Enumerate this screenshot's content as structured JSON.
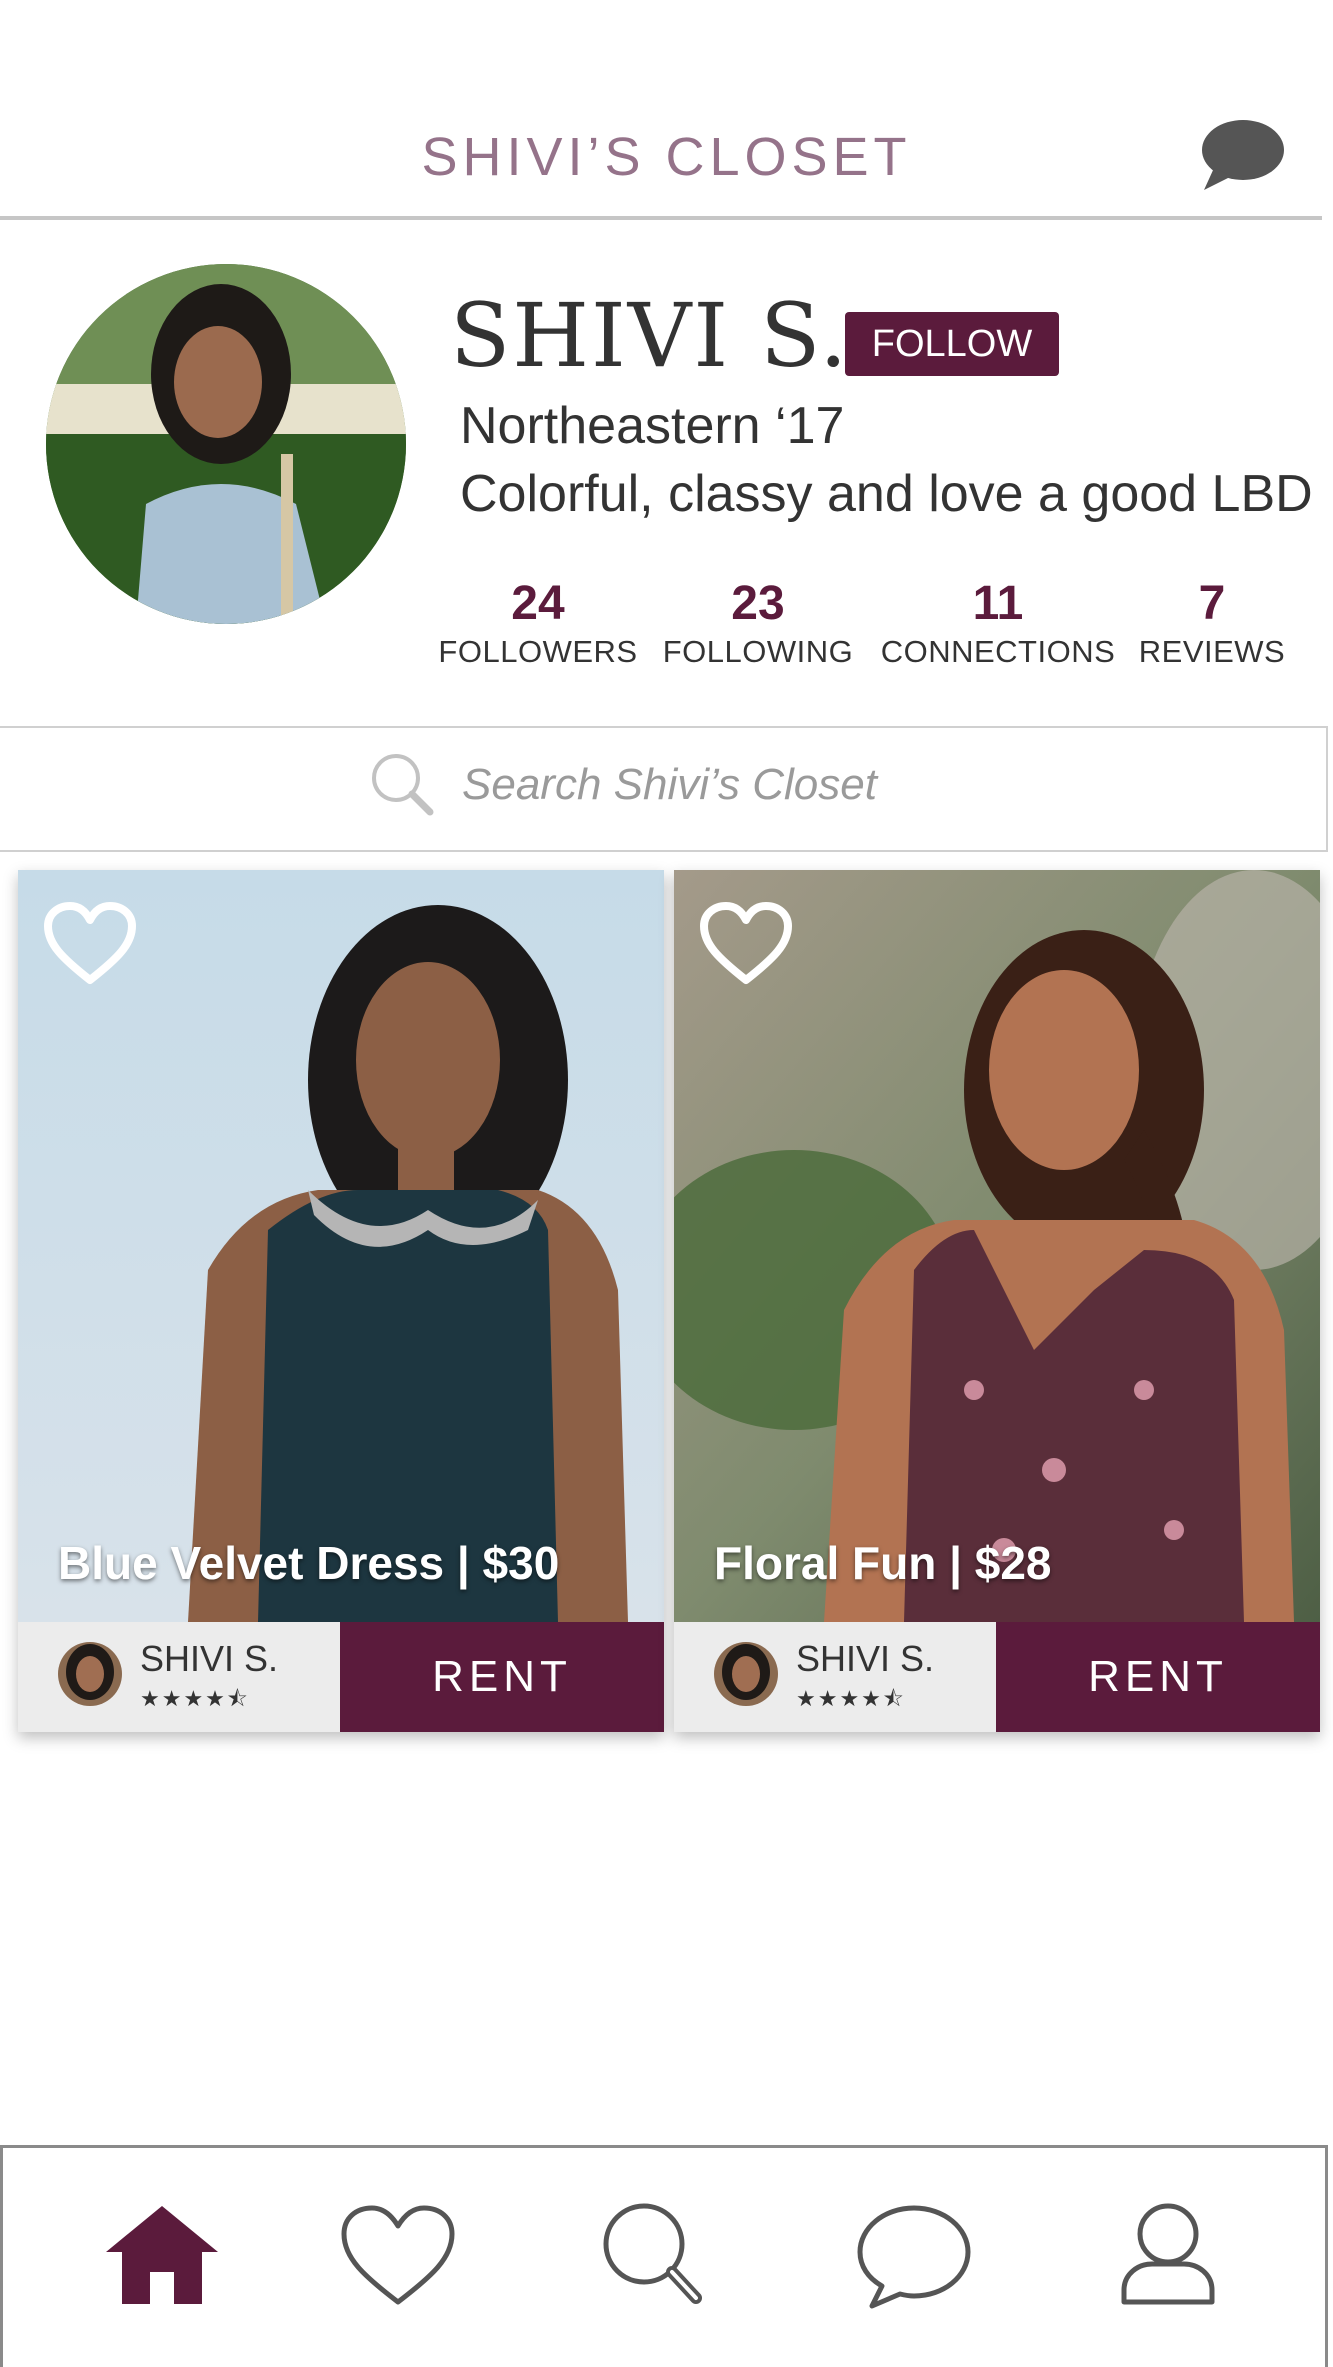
{
  "header": {
    "title": "SHIVI’S CLOSET",
    "chat_icon": "chat-bubble-icon"
  },
  "profile": {
    "name": "SHIVI S.",
    "follow_label": "FOLLOW",
    "school": "Northeastern ‘17",
    "bio": "Colorful, classy and love a good LBD",
    "stats": [
      {
        "value": "24",
        "label": "FOLLOWERS"
      },
      {
        "value": "23",
        "label": "FOLLOWING"
      },
      {
        "value": "11",
        "label": "CONNECTIONS"
      },
      {
        "value": "7",
        "label": "REVIEWS"
      }
    ]
  },
  "search": {
    "placeholder": "Search Shivi’s Closet",
    "icon": "search-icon"
  },
  "listings": [
    {
      "title": "Blue Velvet Dress | $30",
      "seller": "SHIVI S.",
      "rating": 4.5,
      "stars": "★★★★⯪",
      "rent_label": "RENT"
    },
    {
      "title": "Floral Fun | $28",
      "seller": "SHIVI S.",
      "rating": 4.5,
      "stars": "★★★★⯪",
      "rent_label": "RENT"
    }
  ],
  "bottom_nav": [
    {
      "icon": "home-icon",
      "active": true
    },
    {
      "icon": "heart-icon",
      "active": false
    },
    {
      "icon": "search-icon",
      "active": false
    },
    {
      "icon": "chat-icon",
      "active": false
    },
    {
      "icon": "profile-icon",
      "active": false
    }
  ],
  "colors": {
    "brand": "#5b1b3c",
    "title": "#95738a",
    "icon_gray": "#555555"
  }
}
